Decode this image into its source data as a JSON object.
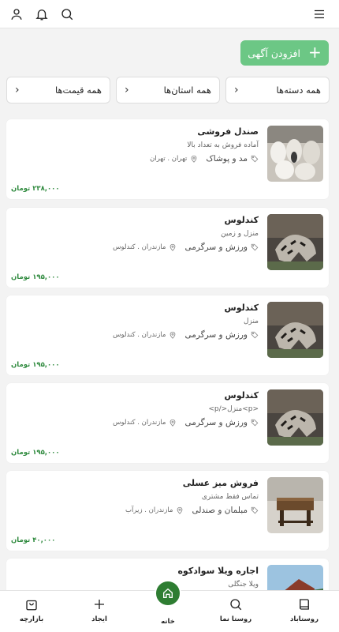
{
  "header": {
    "menu_icon": "menu-icon",
    "search_icon": "search-icon",
    "notification_icon": "bell-icon",
    "profile_icon": "user-icon"
  },
  "actions": {
    "add_ad_label": "افزودن آگهی",
    "add_icon": "plus-icon",
    "accent": "#6cc785"
  },
  "filters": [
    {
      "label": "همه دسته‌ها"
    },
    {
      "label": "همه استان‌ها"
    },
    {
      "label": "همه قیمت‌ها"
    }
  ],
  "listings": [
    {
      "title": "صندل فروشی",
      "subtitle": "آماده فروش به تعداد بالا",
      "category": "مد و پوشاک",
      "location": "تهران . تهران",
      "price": "۲۳۸,۰۰۰ تومان",
      "image": "sandals"
    },
    {
      "title": "کندلوس",
      "subtitle": "منزل و زمین",
      "category": "ورزش و سرگرمی",
      "location": "مازندران . کندلوس",
      "price": "۱۹۵,۰۰۰ تومان",
      "image": "tiger-figure"
    },
    {
      "title": "کندلوس",
      "subtitle": "منزل",
      "category": "ورزش و سرگرمی",
      "location": "مازندران . کندلوس",
      "price": "۱۹۵,۰۰۰ تومان",
      "image": "tiger-figure"
    },
    {
      "title": "کندلوس",
      "subtitle": "<p>منزل</p>",
      "category": "ورزش و سرگرمی",
      "location": "مازندران . کندلوس",
      "price": "۱۹۵,۰۰۰ تومان",
      "image": "tiger-figure"
    },
    {
      "title": "فروش میز عسلی",
      "subtitle": "تماس فقط مشتری",
      "category": "مبلمان و صندلی",
      "location": "مازندران . زیرآب",
      "price": "۴۰,۰۰۰ تومان",
      "image": "wooden-table"
    },
    {
      "title": "اجاره ویلا سوادکوه",
      "subtitle": "ویلا جنگلی",
      "category": "",
      "location": "",
      "price": "",
      "image": "villa"
    }
  ],
  "bottom_nav": {
    "market": {
      "label": "بازارچه",
      "icon": "shopping-bag-icon"
    },
    "create": {
      "label": "ایجاد",
      "icon": "plus-icon"
    },
    "home": {
      "label": "خانه",
      "icon": "home-icon",
      "color": "#2e7d32"
    },
    "village_view": {
      "label": "روستا نما",
      "icon": "search-icon"
    },
    "village_abad": {
      "label": "روستاباد",
      "icon": "book-icon"
    }
  }
}
